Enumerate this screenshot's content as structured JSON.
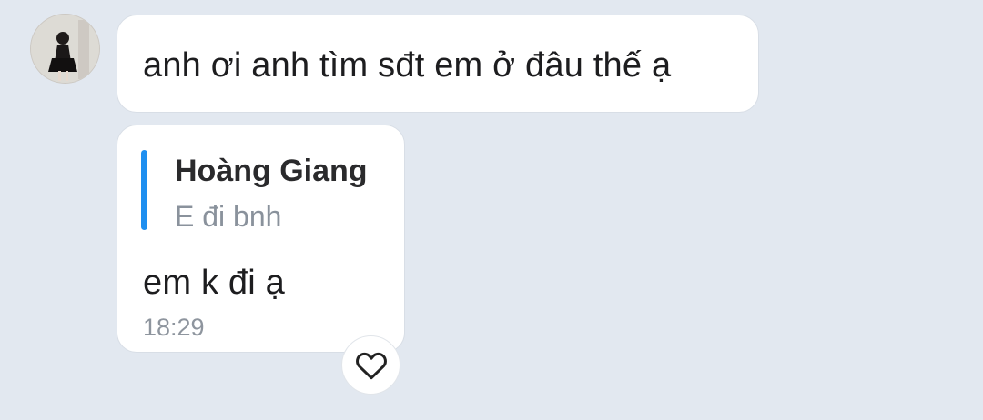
{
  "chat": {
    "messages": [
      {
        "text": "anh ơi anh tìm sđt em ở đâu thế ạ"
      },
      {
        "quote": {
          "author": "Hoàng Giang",
          "text": "E đi bnh"
        },
        "text": "em k đi ạ",
        "time": "18:29"
      }
    ]
  },
  "icons": {
    "avatar": "avatar",
    "reaction": "heart-icon"
  },
  "colors": {
    "background": "#e2e8f0",
    "bubble": "#ffffff",
    "quote_bar": "#1e8ff0",
    "secondary_text": "#8a929c"
  }
}
